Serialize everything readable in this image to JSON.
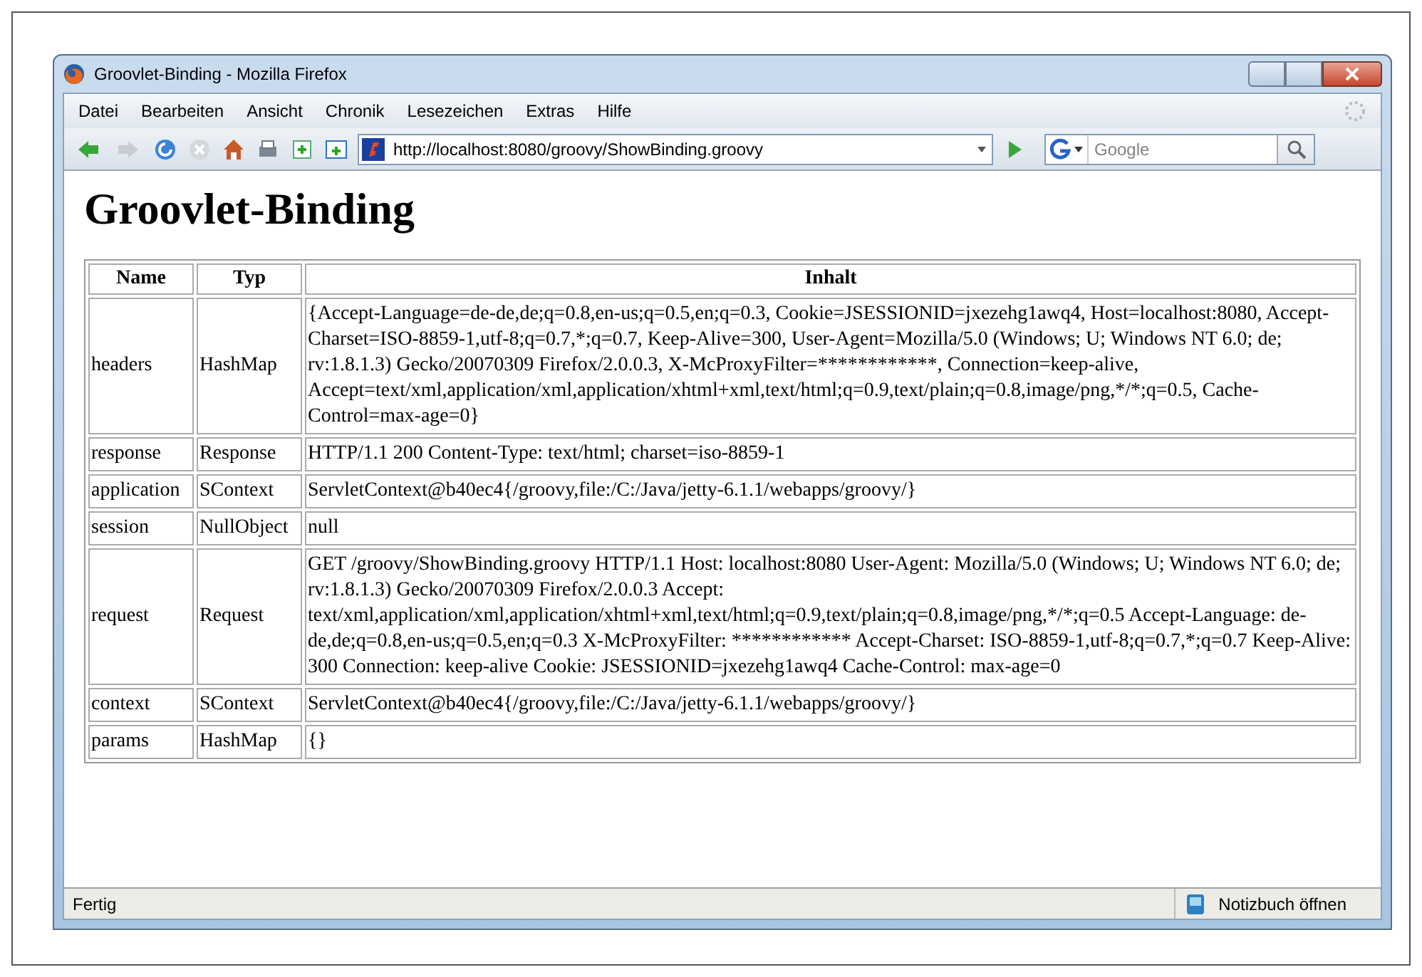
{
  "window": {
    "title": "Groovlet-Binding - Mozilla Firefox"
  },
  "menu": [
    "Datei",
    "Bearbeiten",
    "Ansicht",
    "Chronik",
    "Lesezeichen",
    "Extras",
    "Hilfe"
  ],
  "address": {
    "value": "http://localhost:8080/groovy/ShowBinding.groovy"
  },
  "search": {
    "placeholder": "Google"
  },
  "page": {
    "heading": "Groovlet-Binding",
    "table": {
      "columns": [
        "Name",
        "Typ",
        "Inhalt"
      ],
      "rows": [
        [
          "headers",
          "HashMap",
          "{Accept-Language=de-de,de;q=0.8,en-us;q=0.5,en;q=0.3, Cookie=JSESSIONID=jxezehg1awq4, Host=localhost:8080, Accept-Charset=ISO-8859-1,utf-8;q=0.7,*;q=0.7, Keep-Alive=300, User-Agent=Mozilla/5.0 (Windows; U; Windows NT 6.0; de; rv:1.8.1.3) Gecko/20070309 Firefox/2.0.0.3, X-McProxyFilter=************, Connection=keep-alive, Accept=text/xml,application/xml,application/xhtml+xml,text/html;q=0.9,text/plain;q=0.8,image/png,*/*;q=0.5, Cache-Control=max-age=0}"
        ],
        [
          "response",
          "Response",
          "HTTP/1.1 200 Content-Type: text/html; charset=iso-8859-1"
        ],
        [
          "application",
          "SContext",
          "ServletContext@b40ec4{/groovy,file:/C:/Java/jetty-6.1.1/webapps/groovy/}"
        ],
        [
          "session",
          "NullObject",
          "null"
        ],
        [
          "request",
          "Request",
          "GET /groovy/ShowBinding.groovy HTTP/1.1 Host: localhost:8080 User-Agent: Mozilla/5.0 (Windows; U; Windows NT 6.0; de; rv:1.8.1.3) Gecko/20070309 Firefox/2.0.0.3 Accept: text/xml,application/xml,application/xhtml+xml,text/html;q=0.9,text/plain;q=0.8,image/png,*/*;q=0.5 Accept-Language: de-de,de;q=0.8,en-us;q=0.5,en;q=0.3 X-McProxyFilter: ************ Accept-Charset: ISO-8859-1,utf-8;q=0.7,*;q=0.7 Keep-Alive: 300 Connection: keep-alive Cookie: JSESSIONID=jxezehg1awq4 Cache-Control: max-age=0"
        ],
        [
          "context",
          "SContext",
          "ServletContext@b40ec4{/groovy,file:/C:/Java/jetty-6.1.1/webapps/groovy/}"
        ],
        [
          "params",
          "HashMap",
          "{}"
        ]
      ]
    }
  },
  "status_bar": {
    "text": "Fertig",
    "notebook": "Notizbuch öffnen"
  }
}
